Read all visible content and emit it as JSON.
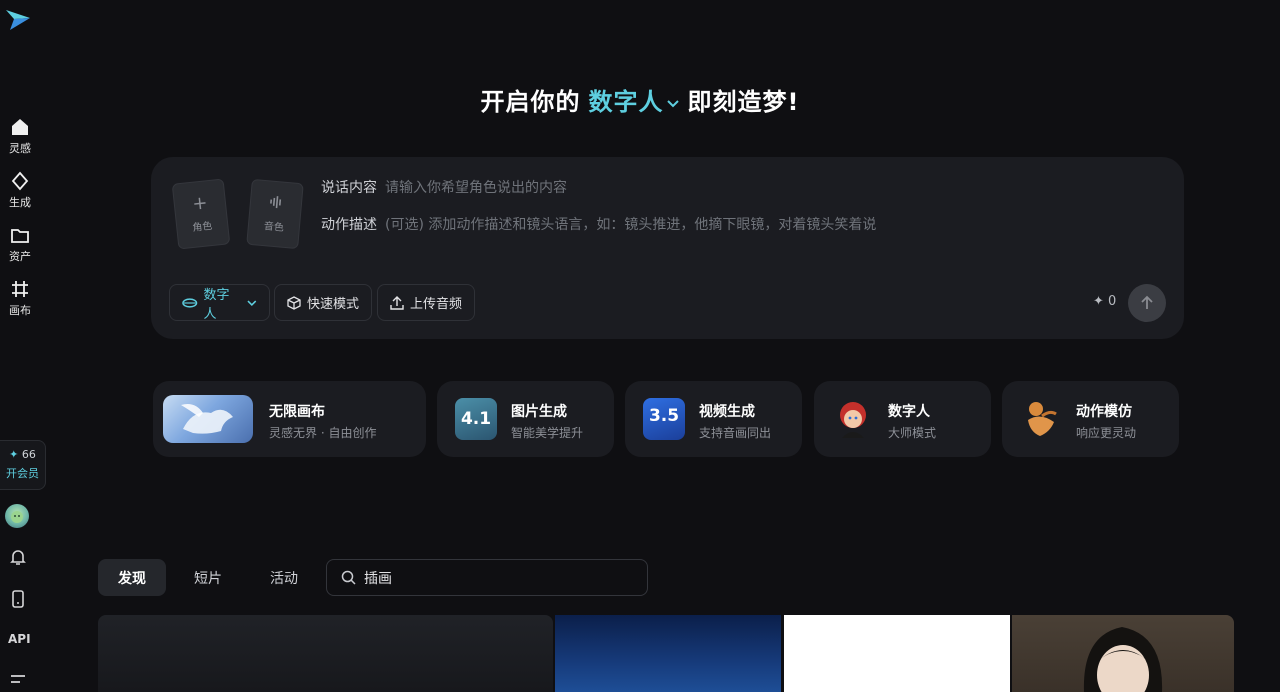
{
  "sidebar": {
    "items": [
      {
        "label": "灵感",
        "icon": "home-icon"
      },
      {
        "label": "生成",
        "icon": "sparkle-diamond-icon"
      },
      {
        "label": "资产",
        "icon": "folder-icon"
      },
      {
        "label": "画布",
        "icon": "canvas-grid-icon"
      }
    ],
    "vip": {
      "points": "66",
      "label": "开会员"
    },
    "api_label": "API"
  },
  "headline": {
    "prefix": "开启你的",
    "accent": "数字人",
    "suffix": "即刻造梦!"
  },
  "composer": {
    "slot_character": "角色",
    "slot_voice": "音色",
    "speech_label": "说话内容",
    "speech_placeholder": "请输入你希望角色说出的内容",
    "action_label": "动作描述",
    "action_placeholder": "(可选) 添加动作描述和镜头语言，如：镜头推进，他摘下眼镜，对着镜头笑着说",
    "mode_chip": "数字人",
    "fast_chip": "快速模式",
    "upload_chip": "上传音频",
    "credits": "0"
  },
  "features": [
    {
      "title": "无限画布",
      "subtitle": "灵感无界 · 自由创作"
    },
    {
      "title": "图片生成",
      "subtitle": "智能美学提升",
      "badge": "4.1"
    },
    {
      "title": "视频生成",
      "subtitle": "支持音画同出",
      "badge": "3.5"
    },
    {
      "title": "数字人",
      "subtitle": "大师模式"
    },
    {
      "title": "动作模仿",
      "subtitle": "响应更灵动"
    }
  ],
  "tabs": [
    "发现",
    "短片",
    "活动"
  ],
  "search": {
    "value": "插画"
  },
  "colors": {
    "accent": "#5ecfe0",
    "background": "#0f0f12",
    "surface": "#1b1c21"
  }
}
